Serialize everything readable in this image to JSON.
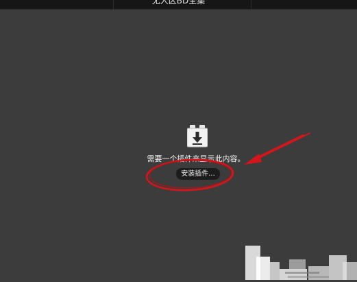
{
  "window": {
    "title": "无人区BD全集"
  },
  "plugin_notice": {
    "icon": "plugin-download-icon",
    "message": "需要一个插件来显示此内容。",
    "install_button_label": "安装插件..."
  },
  "colors": {
    "background": "#3c3c3c",
    "titlebar": "#161616",
    "button": "#1c1c1c",
    "annotation_red": "#d4161c"
  }
}
